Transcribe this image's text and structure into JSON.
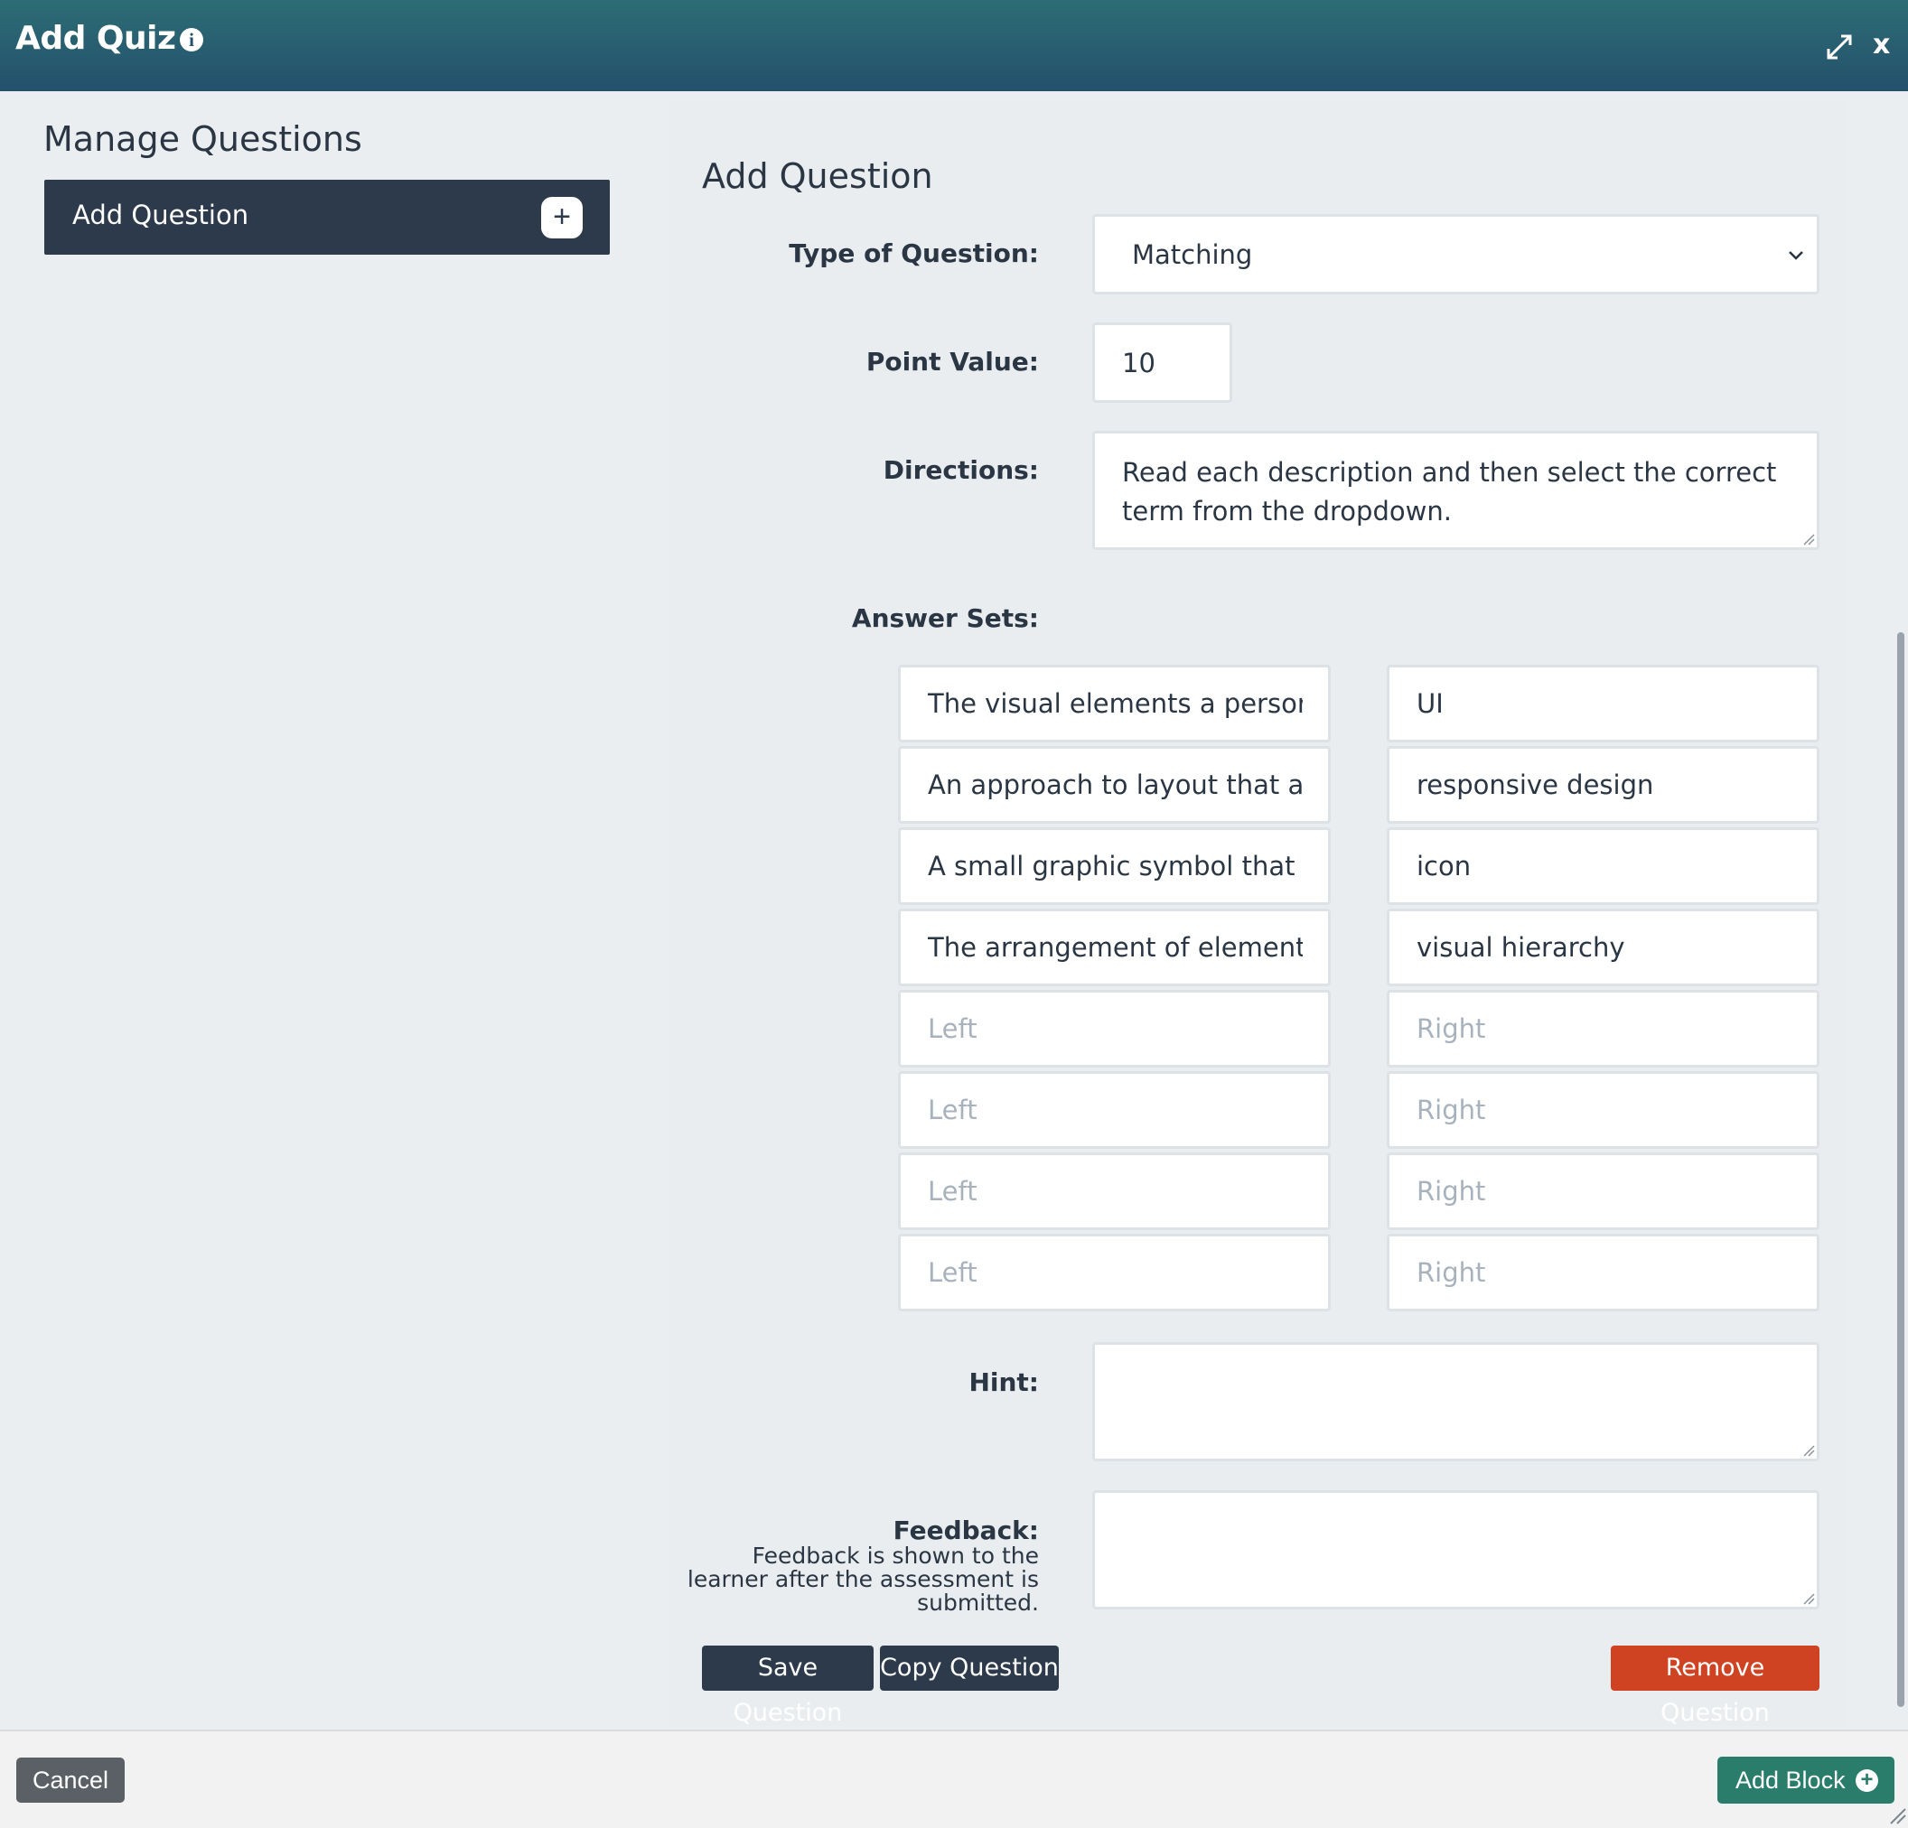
{
  "header": {
    "title": "Add Quiz",
    "info_icon": "info-icon",
    "expand_icon": "expand-icon",
    "close_label": "x"
  },
  "sidebar": {
    "title": "Manage Questions",
    "add_question_label": "Add Question",
    "add_icon": "plus-icon"
  },
  "form": {
    "title": "Add Question",
    "type_label": "Type of Question:",
    "type_value": "Matching",
    "points_label": "Point Value:",
    "points_value": "10",
    "directions_label": "Directions:",
    "directions_value": "Read each description and then select the correct term from the dropdown.",
    "answer_sets_label": "Answer Sets:",
    "answer_sets": [
      {
        "left": "The visual elements a person int",
        "right": "UI"
      },
      {
        "left": "An approach to layout that adjus",
        "right": "responsive design"
      },
      {
        "left": "A small graphic symbol that repr",
        "right": "icon"
      },
      {
        "left": "The arrangement of elements th",
        "right": "visual hierarchy"
      },
      {
        "left": "",
        "right": ""
      },
      {
        "left": "",
        "right": ""
      },
      {
        "left": "",
        "right": ""
      },
      {
        "left": "",
        "right": ""
      }
    ],
    "left_placeholder": "Left",
    "right_placeholder": "Right",
    "hint_label": "Hint:",
    "hint_value": "",
    "feedback_label": "Feedback:",
    "feedback_help": "Feedback is shown to the learner after the assessment is submitted.",
    "feedback_value": ""
  },
  "actions": {
    "save": "Save Question",
    "copy": "Copy Question",
    "remove": "Remove Question"
  },
  "footer": {
    "cancel": "Cancel",
    "add_block": "Add Block",
    "add_block_icon": "plus-circle-icon"
  },
  "colors": {
    "header_top": "#2d6d75",
    "header_bottom": "#24506c",
    "dark": "#2c3a4c",
    "danger": "#cf4322",
    "success": "#2a7c6b"
  }
}
